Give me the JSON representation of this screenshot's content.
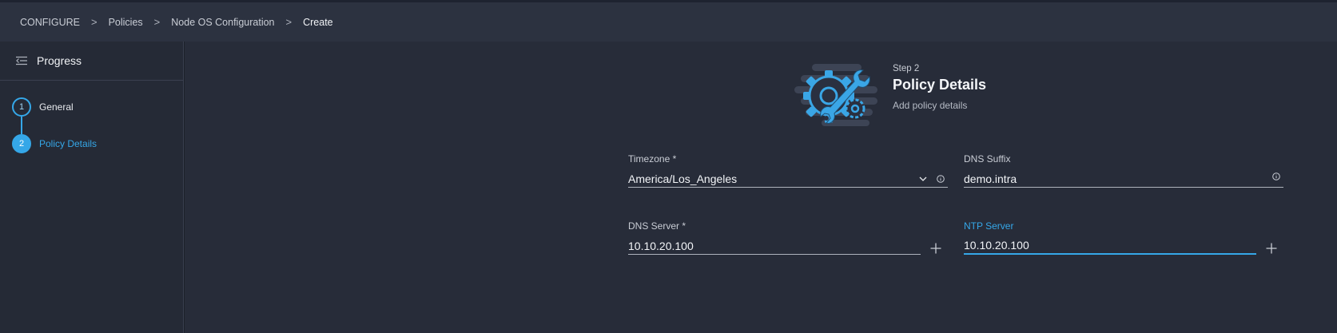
{
  "breadcrumb": {
    "items": [
      "CONFIGURE",
      "Policies",
      "Node OS Configuration"
    ],
    "current": "Create",
    "separator": ">"
  },
  "sidebar": {
    "title": "Progress",
    "steps": [
      {
        "number": "1",
        "label": "General",
        "state": "done"
      },
      {
        "number": "2",
        "label": "Policy Details",
        "state": "active"
      }
    ]
  },
  "main": {
    "step_number": "Step 2",
    "step_title": "Policy Details",
    "step_subtitle": "Add policy details",
    "fields": {
      "timezone": {
        "label": "Timezone *",
        "value": "America/Los_Angeles"
      },
      "dns_suffix": {
        "label": "DNS Suffix",
        "value": "demo.intra"
      },
      "dns_server": {
        "label": "DNS Server *",
        "value": "10.10.20.100"
      },
      "ntp_server": {
        "label": "NTP Server",
        "value": "10.10.20.100"
      }
    }
  },
  "icons": {
    "collapse": "collapse-panel-icon",
    "chevron": "chevron-down-icon",
    "info": "info-icon",
    "add": "plus-icon",
    "illustration": "gear-wrench-illustration"
  },
  "colors": {
    "accent": "#35a7e8",
    "header_bg": "#2c3240",
    "sidebar_bg": "#252a36",
    "main_bg": "#272c39"
  }
}
